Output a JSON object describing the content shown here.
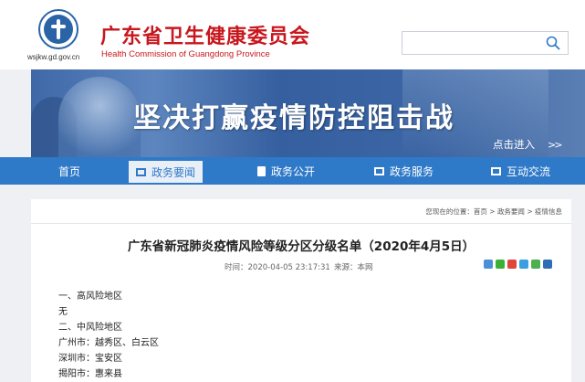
{
  "header": {
    "domain": "wsjkw.gd.gov.cn",
    "title": "广东省卫生健康委员会",
    "subtitle": "Health Commission of Guangdong Province",
    "search_placeholder": ""
  },
  "banner": {
    "slogan": "坚决打赢疫情防控阻击战",
    "enter_label": "点击进入",
    "arrows": ">>"
  },
  "nav": {
    "items": [
      {
        "label": "首页",
        "icon": "none"
      },
      {
        "label": "政务要闻",
        "icon": "news-icon",
        "active": true
      },
      {
        "label": "政务公开",
        "icon": "document-icon"
      },
      {
        "label": "政务服务",
        "icon": "service-icon"
      },
      {
        "label": "互动交流",
        "icon": "chat-icon"
      }
    ]
  },
  "article": {
    "breadcrumb": {
      "prefix": "您现在的位置：",
      "home": "首页",
      "sep": " > ",
      "level1": "政务要闻",
      "level2": "疫情信息"
    },
    "title": "广东省新冠肺炎疫情风险等级分区分级名单（2020年4月5日）",
    "time_label": "时间：",
    "time_value": "2020-04-05 23:17:31",
    "source_label": "来源：",
    "source_value": "本网",
    "share_icons": [
      "qzone-icon",
      "wechat-icon",
      "weibo-icon",
      "tencent-weibo-icon",
      "douban-icon",
      "renren-icon"
    ],
    "body": [
      "一、高风险地区",
      "无",
      "二、中风险地区",
      "广州市：越秀区、白云区",
      "深圳市：宝安区",
      "揭阳市：惠来县"
    ]
  },
  "colors": {
    "brand_red": "#c8171e",
    "nav_blue": "#2f79c9"
  }
}
